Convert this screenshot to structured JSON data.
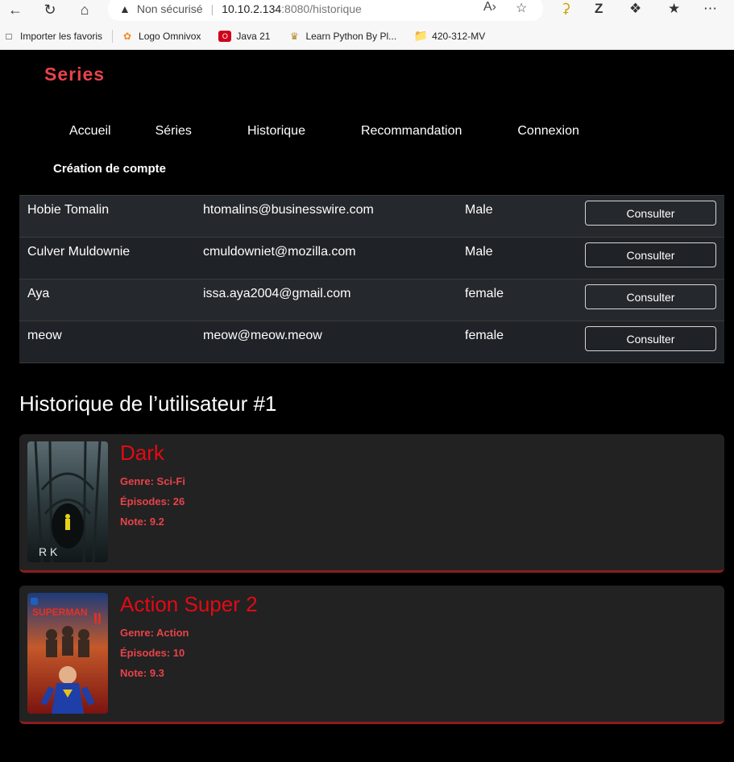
{
  "browser": {
    "insecure_label": "Non sécurisé",
    "url_host": "10.10.2.134",
    "url_rest": ":8080/historique",
    "bookmarks": [
      {
        "label": "Importer les favoris"
      },
      {
        "label": "Logo Omnivox"
      },
      {
        "label": "Java 21"
      },
      {
        "label": "Learn Python By Pl..."
      },
      {
        "label": "420-312-MV"
      }
    ]
  },
  "site": {
    "brand": "Series",
    "nav": [
      "Accueil",
      "Séries",
      "Historique",
      "Recommandation",
      "Connexion"
    ],
    "nav_sub": "Création de compte"
  },
  "users": [
    {
      "name": "Hobie Tomalin",
      "email": "htomalins@businesswire.com",
      "gender": "Male",
      "action": "Consulter"
    },
    {
      "name": "Culver Muldownie",
      "email": "cmuldowniet@mozilla.com",
      "gender": "Male",
      "action": "Consulter"
    },
    {
      "name": "Aya",
      "email": "issa.aya2004@gmail.com",
      "gender": "female",
      "action": "Consulter"
    },
    {
      "name": "meow",
      "email": "meow@meow.meow",
      "gender": "female",
      "action": "Consulter"
    }
  ],
  "history": {
    "title": "Historique de l’utilisateur #1",
    "genre_label": "Genre:",
    "episodes_label": "Épisodes:",
    "note_label": "Note:",
    "series": [
      {
        "title": "Dark",
        "genre": "Sci-Fi",
        "episodes": "26",
        "note": "9.2",
        "poster_text": "R  K"
      },
      {
        "title": "Action Super 2",
        "genre": "Action",
        "episodes": "10",
        "note": "9.3",
        "poster_text": "SUPERMAN"
      }
    ]
  }
}
